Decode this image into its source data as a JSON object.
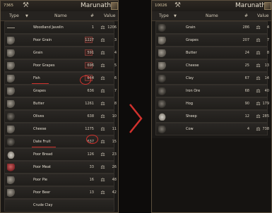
{
  "left_panel": {
    "gold": "7365",
    "settlement": "Marunath",
    "columns": {
      "type": "Type",
      "name": "Name",
      "count": "#",
      "value": "Value"
    },
    "rows": [
      {
        "name": "Woodland Javelin",
        "count": "1",
        "value": "1206",
        "thumb": "strip"
      },
      {
        "name": "Poor Grain",
        "count": "1227",
        "value": "3",
        "thumb": "default",
        "box": true
      },
      {
        "name": "Grain",
        "count": "591",
        "value": "4",
        "thumb": "default",
        "box": true
      },
      {
        "name": "Poor Grapes",
        "count": "696",
        "value": "5",
        "thumb": "default",
        "box": true
      },
      {
        "name": "Fish",
        "count": "644",
        "value": "6",
        "thumb": "default",
        "box": true
      },
      {
        "name": "Grapes",
        "count": "636",
        "value": "7",
        "thumb": "default"
      },
      {
        "name": "Butter",
        "count": "1261",
        "value": "8",
        "thumb": "default"
      },
      {
        "name": "Olives",
        "count": "638",
        "value": "10",
        "thumb": "dark"
      },
      {
        "name": "Cheese",
        "count": "1275",
        "value": "11",
        "thumb": "default"
      },
      {
        "name": "Date Fruit",
        "count": "637",
        "value": "15",
        "thumb": "dark"
      },
      {
        "name": "Poor Bread",
        "count": "126",
        "value": "23",
        "thumb": "egg"
      },
      {
        "name": "Poor Meat",
        "count": "33",
        "value": "26",
        "thumb": "red"
      },
      {
        "name": "Poor Pie",
        "count": "16",
        "value": "48",
        "thumb": "default"
      },
      {
        "name": "Poor Beer",
        "count": "13",
        "value": "42",
        "thumb": "default"
      },
      {
        "name": "Crude Clay",
        "count": "",
        "value": "",
        "thumb": "blank"
      }
    ]
  },
  "right_panel": {
    "gold": "10026",
    "settlement": "Marunath",
    "columns": {
      "type": "Type",
      "name": "Name",
      "count": "#",
      "value": "Value"
    },
    "rows": [
      {
        "name": "Grain",
        "count": "286",
        "value": "4",
        "thumb": "dark"
      },
      {
        "name": "Grapes",
        "count": "207",
        "value": "7",
        "thumb": "default"
      },
      {
        "name": "Butter",
        "count": "24",
        "value": "8",
        "thumb": "default"
      },
      {
        "name": "Cheese",
        "count": "25",
        "value": "13",
        "thumb": "default"
      },
      {
        "name": "Clay",
        "count": "67",
        "value": "14",
        "thumb": "dark"
      },
      {
        "name": "Iron Ore",
        "count": "68",
        "value": "40",
        "thumb": "dark"
      },
      {
        "name": "Hog",
        "count": "90",
        "value": "179",
        "thumb": "dark"
      },
      {
        "name": "Sheep",
        "count": "12",
        "value": "285",
        "thumb": "egg"
      },
      {
        "name": "Cow",
        "count": "4",
        "value": "738",
        "thumb": "dark"
      }
    ]
  },
  "colors": {
    "accent_red": "#d0312d",
    "panel": "#1a1816",
    "border": "#5b4f3e"
  },
  "icons": {
    "hammer": "hammer-icon",
    "sell": "sell-icon",
    "arrow": "chevron-right-arrow-icon"
  }
}
